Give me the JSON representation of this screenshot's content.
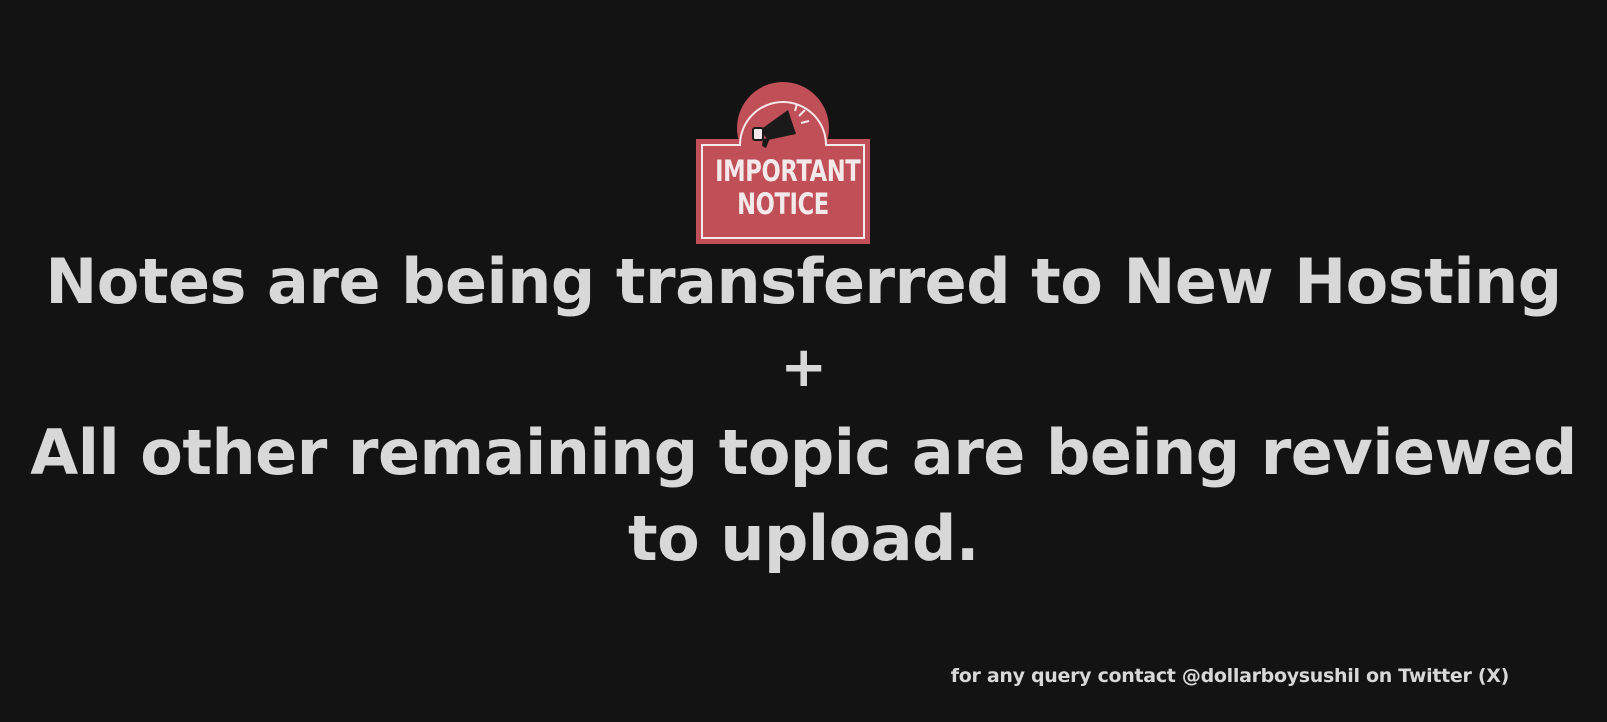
{
  "badge": {
    "line1": "IMPORTANT",
    "line2": "NOTICE",
    "icon": "megaphone-icon",
    "color": "#c14f57",
    "text_color": "#f4e9ea"
  },
  "message": {
    "line1": "Notes are being transferred to New Hosting",
    "separator": "+",
    "line2": "All other remaining topic are being reviewed",
    "line3": "to upload."
  },
  "footer": {
    "contact": "for any query contact @dollarboysushil on Twitter (X)"
  },
  "colors": {
    "background": "#131313",
    "text": "#d8d8d8"
  }
}
